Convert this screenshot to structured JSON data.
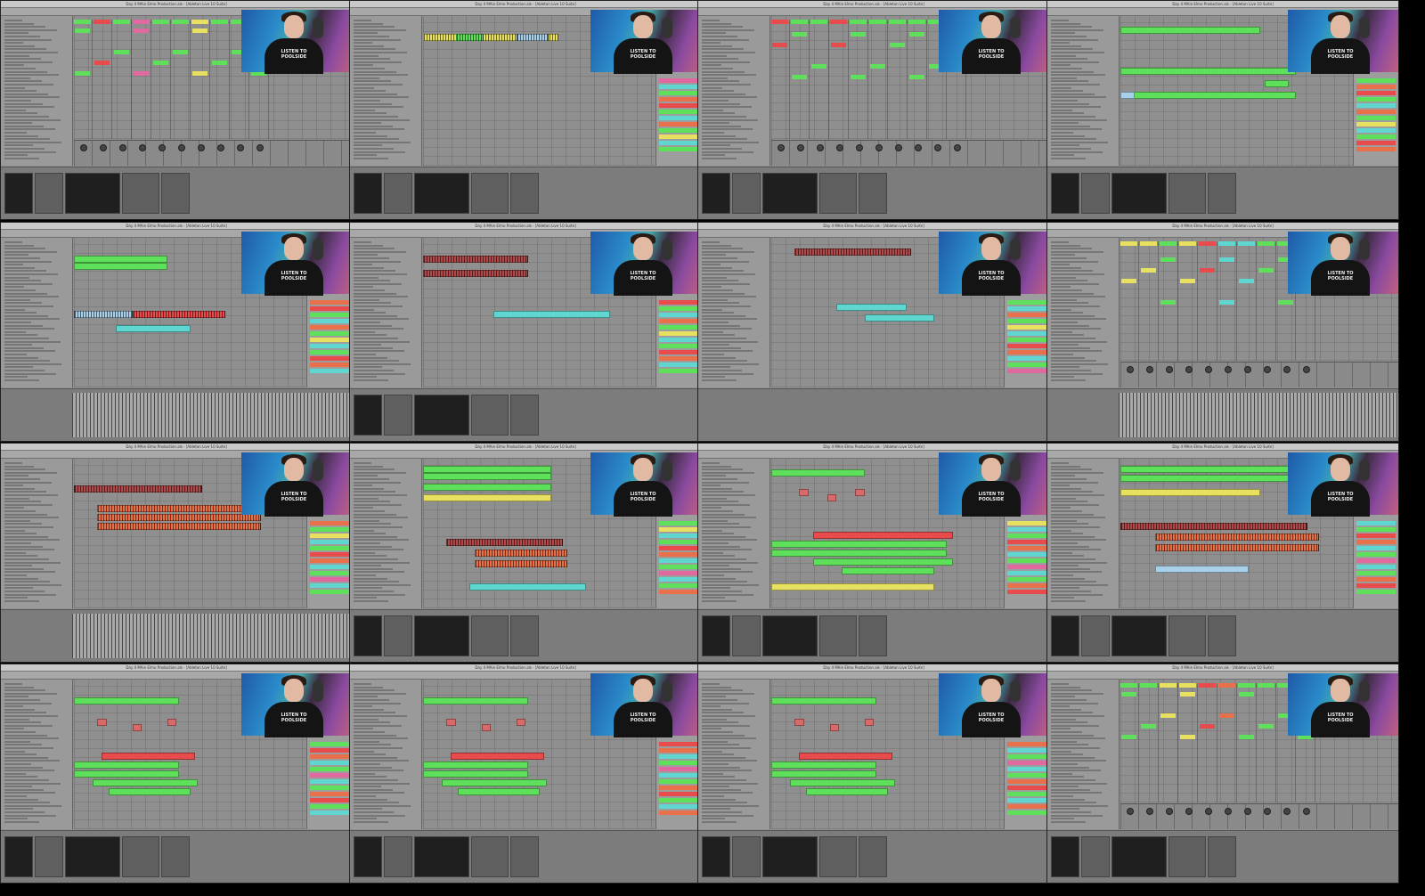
{
  "window_title": "Day 4 MAin Elmo Production.als - [Ableton Live 10 Suite]",
  "webcam_shirt_text": "LISTEN TO\nPOOLSIDE",
  "colors": {
    "green": "#5fe05a",
    "red": "#e84b4b",
    "orange": "#e8704a",
    "yellow": "#e8e060",
    "cyan": "#5fd7d0",
    "salmon": "#d86a6a",
    "pink": "#e06aa0",
    "lightblue": "#a8d0e8",
    "wave_red": "#b04a4a",
    "wave_dark": "#3a3a3a"
  },
  "panels": [
    {
      "view": "session",
      "label": "Session View"
    },
    {
      "view": "arrangement",
      "label": "Arrangement View"
    },
    {
      "view": "session",
      "label": "Session View"
    },
    {
      "view": "arrangement",
      "label": "Arrangement View"
    },
    {
      "view": "arrangement",
      "label": "Arrangement View"
    },
    {
      "view": "arrangement",
      "label": "Arrangement View"
    },
    {
      "view": "arrangement",
      "label": "Arrangement View"
    },
    {
      "view": "session",
      "label": "Session View"
    },
    {
      "view": "arrangement",
      "label": "Arrangement View"
    },
    {
      "view": "arrangement",
      "label": "Arrangement View"
    },
    {
      "view": "arrangement",
      "label": "Arrangement View"
    },
    {
      "view": "arrangement",
      "label": "Arrangement View"
    },
    {
      "view": "arrangement",
      "label": "Arrangement View"
    },
    {
      "view": "arrangement",
      "label": "Arrangement View"
    },
    {
      "view": "arrangement",
      "label": "Arrangement View"
    },
    {
      "view": "session",
      "label": "Session View"
    }
  ]
}
